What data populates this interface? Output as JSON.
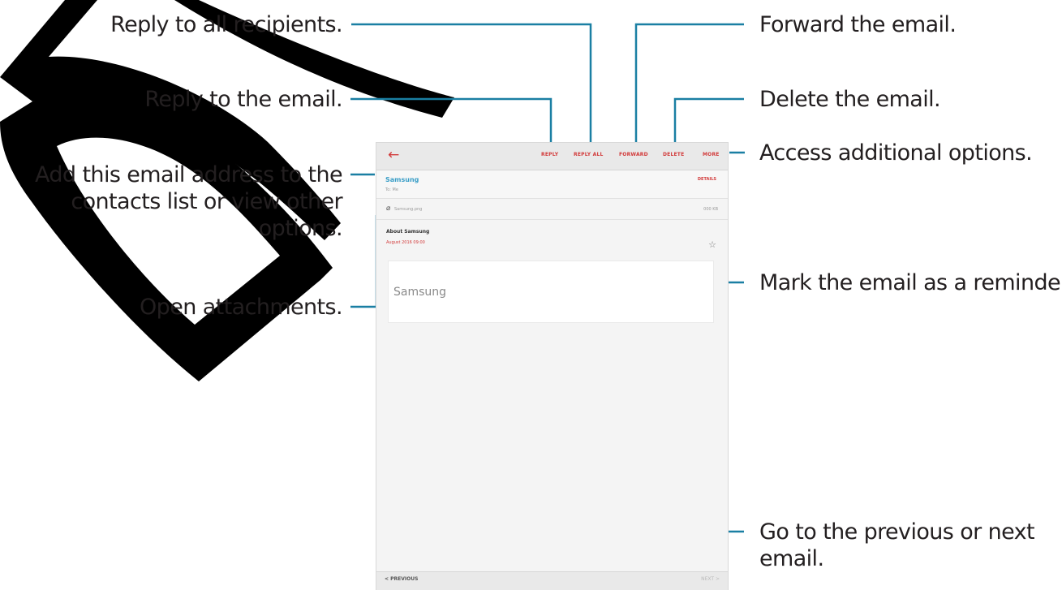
{
  "callouts": {
    "reply_all": "Reply to all recipients.",
    "reply": "Reply to the email.",
    "add_contact_line1": "Add this email address to the",
    "add_contact_line2": "contacts list or view other",
    "add_contact_line3": "options.",
    "attachments": "Open attachments.",
    "forward": "Forward the email.",
    "delete": "Delete the email.",
    "more": "Access additional options.",
    "reminder": "Mark the email as a reminder.",
    "nav_line1": "Go to the previous or next",
    "nav_line2": "email."
  },
  "toolbar": {
    "back_icon": "←",
    "reply": "REPLY",
    "reply_all": "REPLY ALL",
    "forward": "FORWARD",
    "delete": "DELETE",
    "more": "MORE"
  },
  "email": {
    "sender": "Samsung",
    "to": "To: Me",
    "details": "DETAILS",
    "attachment_icon": "⌀",
    "attachment_name": "Samsung.png",
    "attachment_size": "000 KB",
    "subject": "About Samsung",
    "date": "August 2016 09:00",
    "star_icon": "☆",
    "body": "Samsung"
  },
  "navigation": {
    "previous": "< PREVIOUS",
    "next": "NEXT >"
  },
  "colors": {
    "accent_red": "#d23a3a",
    "sender_blue": "#3a9ec7",
    "leader_line": "#1a7fa3"
  }
}
